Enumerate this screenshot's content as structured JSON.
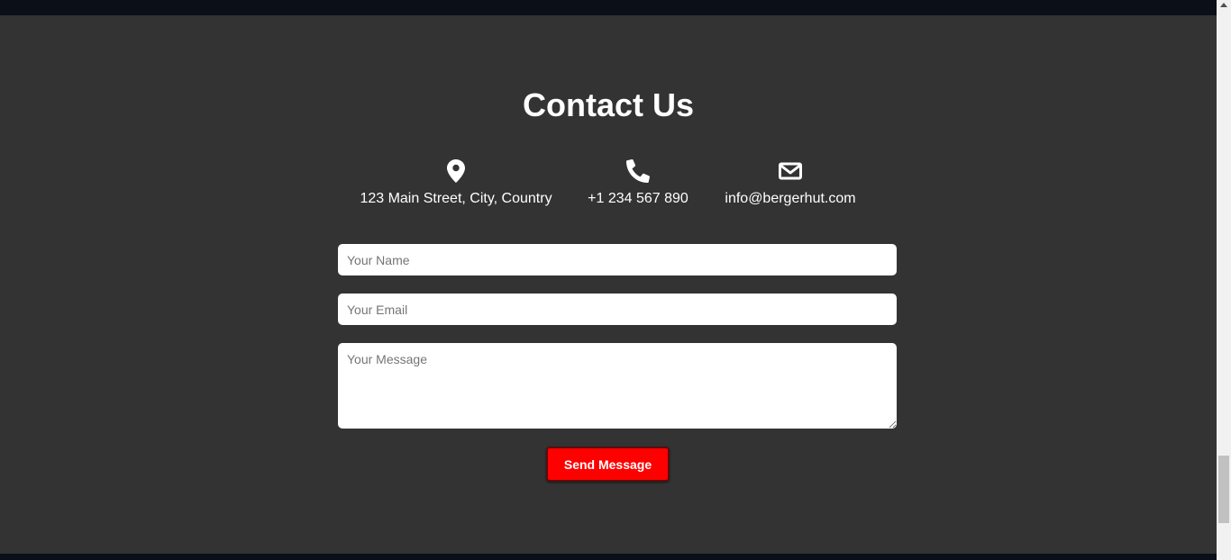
{
  "contact": {
    "title": "Contact Us",
    "info": {
      "address": "123 Main Street, City, Country",
      "phone": "+1 234 567 890",
      "email": "info@bergerhut.com"
    },
    "form": {
      "name_placeholder": "Your Name",
      "email_placeholder": "Your Email",
      "message_placeholder": "Your Message",
      "name_value": "",
      "email_value": "",
      "message_value": "",
      "submit_label": "Send Message"
    },
    "icons": {
      "address": "map-marker-icon",
      "phone": "phone-icon",
      "email": "envelope-icon"
    }
  },
  "colors": {
    "background": "#333333",
    "accent": "#ff0000",
    "text": "#ffffff",
    "header_strip": "#0b0f17"
  }
}
